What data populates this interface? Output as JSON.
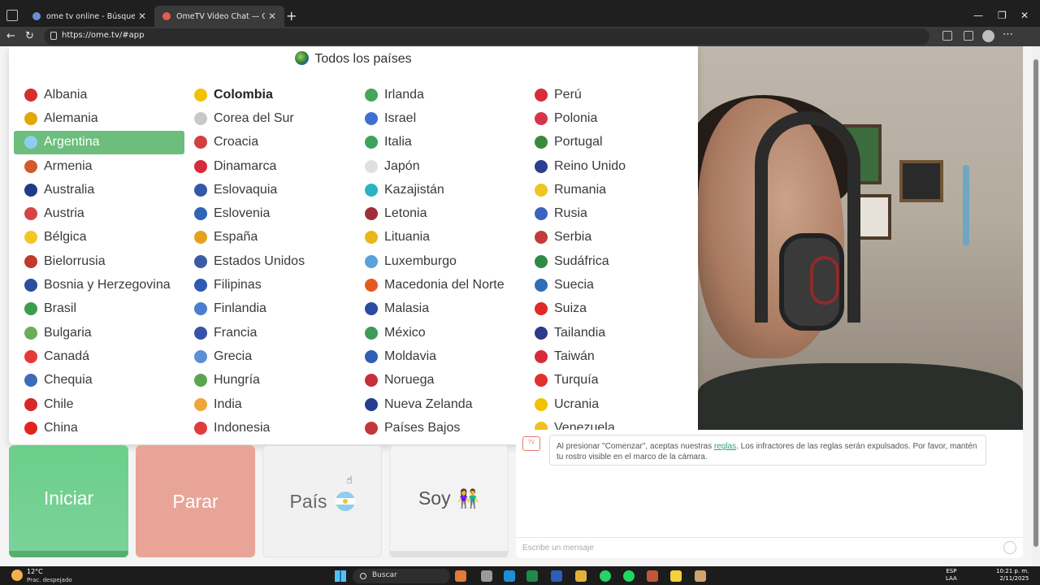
{
  "browser": {
    "tabs": [
      {
        "label": "ome tv online - Búsqueda",
        "favicon_color": "#6b8fd6"
      },
      {
        "label": "OmeTV Video Chat — Ome",
        "favicon_color": "#e55b4d"
      }
    ],
    "url": "https://ome.tv/#app"
  },
  "countries": {
    "header": "Todos los países",
    "columns": [
      [
        {
          "name": "Albania",
          "color": "#d32f2f"
        },
        {
          "name": "Alemania",
          "color": "#e0a800"
        },
        {
          "name": "Argentina",
          "color": "#8ecdf0",
          "selected": true
        },
        {
          "name": "Armenia",
          "color": "#d35a2b"
        },
        {
          "name": "Australia",
          "color": "#1f3c88"
        },
        {
          "name": "Austria",
          "color": "#d64545"
        },
        {
          "name": "Bélgica",
          "color": "#f3c623"
        },
        {
          "name": "Bielorrusia",
          "color": "#c0392b"
        },
        {
          "name": "Bosnia y Herzegovina",
          "color": "#2a4ea0"
        },
        {
          "name": "Brasil",
          "color": "#3b9d4f"
        },
        {
          "name": "Bulgaria",
          "color": "#6aae59"
        },
        {
          "name": "Canadá",
          "color": "#e53935"
        },
        {
          "name": "Chequia",
          "color": "#3e6bb8"
        },
        {
          "name": "Chile",
          "color": "#d62828"
        },
        {
          "name": "China",
          "color": "#e0261b"
        }
      ],
      [
        {
          "name": "Colombia",
          "color": "#f2c200",
          "bold": true
        },
        {
          "name": "Corea del Sur",
          "color": "#c8c8c8"
        },
        {
          "name": "Croacia",
          "color": "#d33f3f"
        },
        {
          "name": "Dinamarca",
          "color": "#d62b3b"
        },
        {
          "name": "Eslovaquia",
          "color": "#3358a8"
        },
        {
          "name": "Eslovenia",
          "color": "#2f64b8"
        },
        {
          "name": "España",
          "color": "#e6a21b"
        },
        {
          "name": "Estados Unidos",
          "color": "#3c5aa6"
        },
        {
          "name": "Filipinas",
          "color": "#2e59b5"
        },
        {
          "name": "Finlandia",
          "color": "#4a7fd0"
        },
        {
          "name": "Francia",
          "color": "#3553a8"
        },
        {
          "name": "Grecia",
          "color": "#5b8fd6"
        },
        {
          "name": "Hungría",
          "color": "#5aa650"
        },
        {
          "name": "India",
          "color": "#f0a53b"
        },
        {
          "name": "Indonesia",
          "color": "#e23b3b"
        }
      ],
      [
        {
          "name": "Irlanda",
          "color": "#46a55a"
        },
        {
          "name": "Israel",
          "color": "#3d6fd1"
        },
        {
          "name": "Italia",
          "color": "#3da35b"
        },
        {
          "name": "Japón",
          "color": "#e0e0e0"
        },
        {
          "name": "Kazajistán",
          "color": "#2bb3c4"
        },
        {
          "name": "Letonia",
          "color": "#9e2f3a"
        },
        {
          "name": "Lituania",
          "color": "#e8b818"
        },
        {
          "name": "Luxemburgo",
          "color": "#5aa2d8"
        },
        {
          "name": "Macedonia del Norte",
          "color": "#e45a1e"
        },
        {
          "name": "Malasia",
          "color": "#2c4aa0"
        },
        {
          "name": "México",
          "color": "#3f9b5b"
        },
        {
          "name": "Moldavia",
          "color": "#2f5fb3"
        },
        {
          "name": "Noruega",
          "color": "#c82d3a"
        },
        {
          "name": "Nueva Zelanda",
          "color": "#253f8f"
        },
        {
          "name": "Países Bajos",
          "color": "#c4363a"
        }
      ],
      [
        {
          "name": "Perú",
          "color": "#d62d3a"
        },
        {
          "name": "Polonia",
          "color": "#d8334a"
        },
        {
          "name": "Portugal",
          "color": "#3a8a3c"
        },
        {
          "name": "Reino Unido",
          "color": "#2a3f8f"
        },
        {
          "name": "Rumania",
          "color": "#f0c523"
        },
        {
          "name": "Rusia",
          "color": "#3d62c0"
        },
        {
          "name": "Serbia",
          "color": "#c33b3b"
        },
        {
          "name": "Sudáfrica",
          "color": "#2f8a45"
        },
        {
          "name": "Suecia",
          "color": "#2f6db8"
        },
        {
          "name": "Suiza",
          "color": "#e02929"
        },
        {
          "name": "Tailandia",
          "color": "#2d3a8a"
        },
        {
          "name": "Taiwán",
          "color": "#d62b3b"
        },
        {
          "name": "Turquía",
          "color": "#e23030"
        },
        {
          "name": "Ucrania",
          "color": "#f2c200"
        },
        {
          "name": "Venezuela",
          "color": "#f0c020"
        }
      ]
    ]
  },
  "controls": {
    "start": "Iniciar",
    "stop": "Parar",
    "country": "País",
    "me": "Soy",
    "me_emoji": "👫"
  },
  "chat": {
    "notice_before": "Al presionar \"Comenzar\", aceptas nuestras ",
    "notice_link": "reglas",
    "notice_after": ". Los infractores de las reglas serán expulsados. Por favor, mantén tu rostro visible en el marco de la cámara.",
    "placeholder": "Escribe un mensaje"
  },
  "taskbar": {
    "temperature": "12°C",
    "weather": "Prac. despejado",
    "search": "Buscar",
    "lang": "ESP",
    "lang2": "LAA",
    "time": "10:21 p. m.",
    "date": "2/11/2025"
  }
}
